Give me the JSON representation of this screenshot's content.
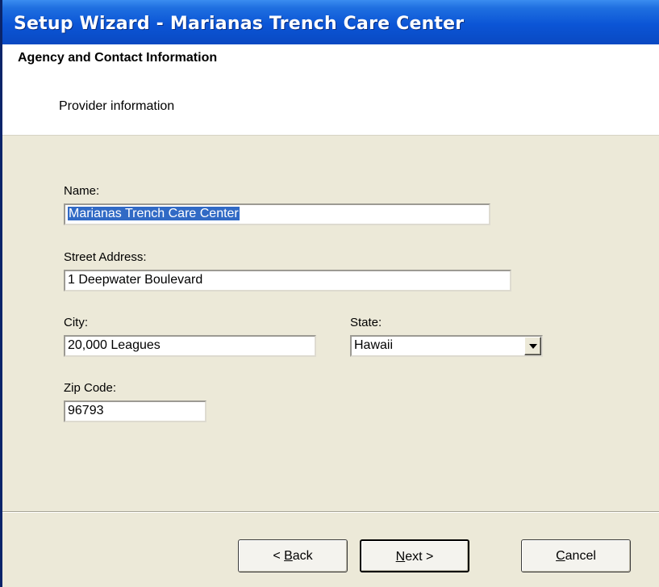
{
  "window": {
    "title": "Setup Wizard - Marianas Trench Care Center"
  },
  "header": {
    "title": "Agency and Contact Information",
    "subtitle": "Provider information"
  },
  "form": {
    "name": {
      "label": "Name:",
      "value": "Marianas Trench Care Center"
    },
    "street": {
      "label": "Street Address:",
      "value": "1 Deepwater Boulevard"
    },
    "city": {
      "label": "City:",
      "value": "20,000 Leagues"
    },
    "state": {
      "label": "State:",
      "value": "Hawaii"
    },
    "zip": {
      "label": "Zip Code:",
      "value": "96793"
    }
  },
  "buttons": {
    "back": {
      "prefix": "< ",
      "mnemonic": "B",
      "rest": "ack"
    },
    "next": {
      "mnemonic": "N",
      "rest": "ext >"
    },
    "cancel": {
      "mnemonic": "C",
      "rest": "ancel"
    }
  },
  "icons": {
    "state_dropdown": "chevron-down-icon"
  },
  "colors": {
    "titlebar": "#0b55d6",
    "selection": "#316ac5",
    "dialog_bg": "#ece9d8"
  }
}
